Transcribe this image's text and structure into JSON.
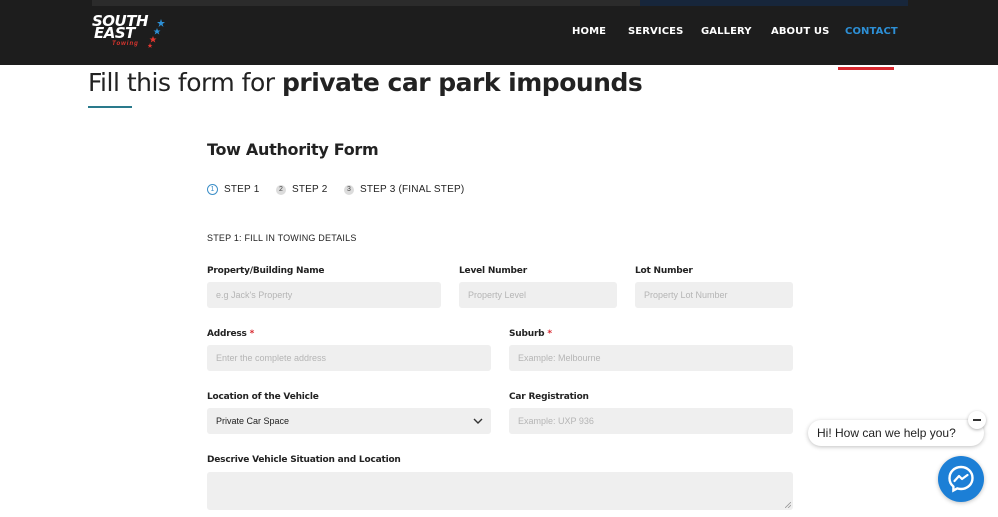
{
  "header": {
    "logo": {
      "line1": "SOUTH",
      "line2": "EAST",
      "line3": "Towing"
    },
    "nav": [
      {
        "label": "HOME",
        "active": false
      },
      {
        "label": "SERVICES",
        "active": false
      },
      {
        "label": "GALLERY",
        "active": false
      },
      {
        "label": "ABOUT US",
        "active": false
      },
      {
        "label": "CONTACT",
        "active": true
      }
    ]
  },
  "page": {
    "title_normal": "Fill this form for ",
    "title_bold": "private car park impounds"
  },
  "form": {
    "title": "Tow Authority Form",
    "steps": [
      {
        "num": "1",
        "label": "STEP 1",
        "active": true
      },
      {
        "num": "2",
        "label": "STEP 2",
        "active": false
      },
      {
        "num": "3",
        "label": "STEP 3 (FINAL STEP)",
        "active": false
      }
    ],
    "step_heading": "STEP 1: FILL IN TOWING DETAILS",
    "fields": {
      "property": {
        "label": "Property/Building Name",
        "placeholder": "e.g Jack's Property"
      },
      "level": {
        "label": "Level Number",
        "placeholder": "Property Level"
      },
      "lot": {
        "label": "Lot Number",
        "placeholder": "Property Lot Number"
      },
      "address": {
        "label": "Address",
        "required": "*",
        "placeholder": "Enter the complete address"
      },
      "suburb": {
        "label": "Suburb",
        "required": "*",
        "placeholder": "Example: Melbourne"
      },
      "location": {
        "label": "Location of the Vehicle",
        "value": "Private Car Space"
      },
      "registration": {
        "label": "Car Registration",
        "placeholder": "Example: UXP 936"
      },
      "situation": {
        "label": "Descrive Vehicle Situation and Location",
        "placeholder": ""
      }
    }
  },
  "chat": {
    "greeting": "Hi! How can we help you?",
    "accent": "#1c7fd6"
  },
  "colors": {
    "header_bg": "#1d1d1d",
    "nav_active": "#2d8fd5",
    "nav_underline": "#d8282f",
    "title_underline": "#2a7a8c",
    "required": "#d8282f",
    "input_bg": "#efefef"
  }
}
